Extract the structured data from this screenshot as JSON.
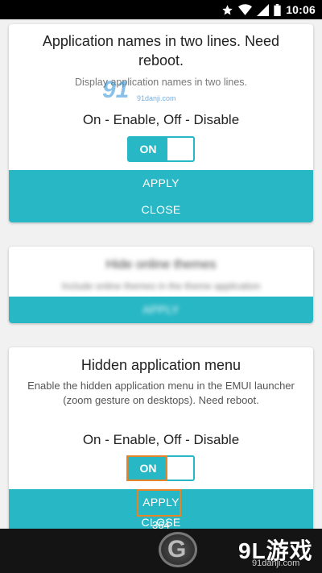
{
  "status_bar": {
    "time": "10:06",
    "icons": [
      "star-icon",
      "wifi-icon",
      "signal-icon",
      "battery-icon"
    ]
  },
  "cards": [
    {
      "title": "Application names in two lines. Need reboot.",
      "description": "Display application names in two lines.",
      "option_text": "On - Enable, Off - Disable",
      "toggle_label": "ON",
      "toggle_state": "on",
      "apply_label": "APPLY",
      "close_label": "CLOSE"
    },
    {
      "title": "Hide online themes",
      "description": "Include online themes in the theme application",
      "action_label": "APPLY"
    },
    {
      "title": "Hidden application menu",
      "description": "Enable the hidden application menu in the EMUI launcher (zoom gesture on desktops). Need reboot.",
      "option_text": "On - Enable, Off - Disable",
      "toggle_label": "ON",
      "toggle_state": "on",
      "apply_label": "APPLY",
      "close_label": "CLOSE"
    }
  ],
  "watermark": {
    "top_brand": "91",
    "top_small": "91danji.com",
    "bottom_brand": "9L游戏",
    "bottom_small": "91danji.com",
    "counter": "364"
  },
  "colors": {
    "accent": "#28b7c5",
    "highlight": "#e4852a",
    "background": "#f1f1f1"
  }
}
